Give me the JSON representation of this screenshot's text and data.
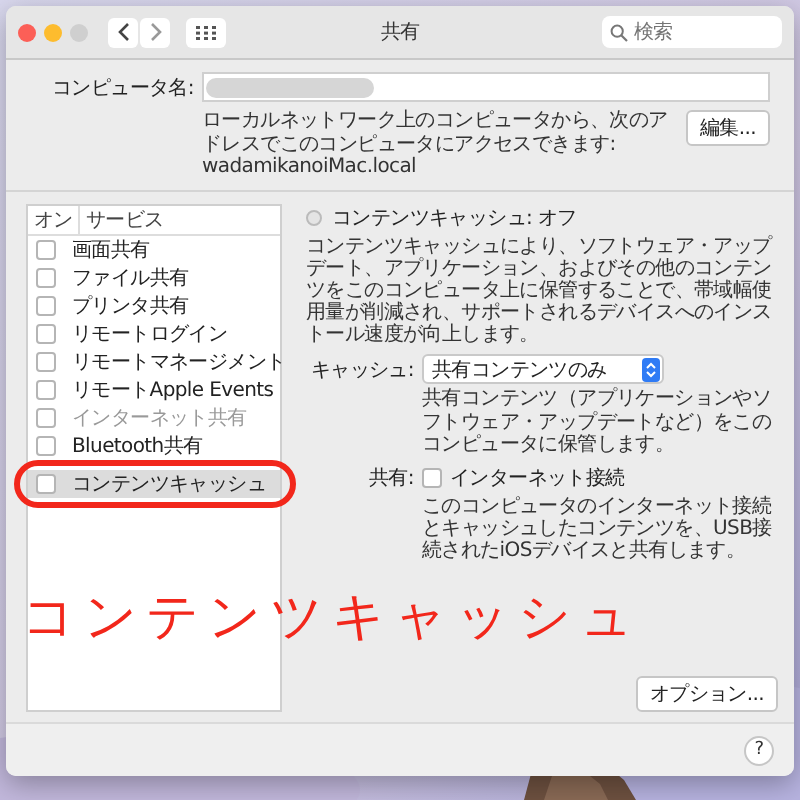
{
  "window": {
    "title": "共有",
    "search": {
      "placeholder": "検索"
    }
  },
  "computer_name": {
    "label": "コンピュータ名:",
    "description": "ローカルネットワーク上のコンピュータから、次のアドレスでこのコンピュータにアクセスできます: wadamikanoiMac.local",
    "edit_button": "編集..."
  },
  "services": {
    "columns": [
      "オン",
      "サービス"
    ],
    "items": [
      {
        "name": "画面共有",
        "checked": false,
        "selected": false,
        "disabled": false
      },
      {
        "name": "ファイル共有",
        "checked": false,
        "selected": false,
        "disabled": false
      },
      {
        "name": "プリンタ共有",
        "checked": false,
        "selected": false,
        "disabled": false
      },
      {
        "name": "リモートログイン",
        "checked": false,
        "selected": false,
        "disabled": false
      },
      {
        "name": "リモートマネージメント",
        "checked": false,
        "selected": false,
        "disabled": false
      },
      {
        "name": "リモートApple Events",
        "checked": false,
        "selected": false,
        "disabled": false
      },
      {
        "name": "インターネット共有",
        "checked": false,
        "selected": false,
        "disabled": true
      },
      {
        "name": "Bluetooth共有",
        "checked": false,
        "selected": false,
        "disabled": false
      },
      {
        "name": "コンテンツキャッシュ",
        "checked": false,
        "selected": true,
        "disabled": false
      }
    ]
  },
  "detail": {
    "status_label": "コンテンツキャッシュ: オフ",
    "status_on": false,
    "description": "コンテンツキャッシュにより、ソフトウェア・アップデート、アプリケーション、およびその他のコンテンツをこのコンピュータ上に保管することで、帯域幅使用量が削減され、サポートされるデバイスへのインストール速度が向上します。",
    "cache_label": "キャッシュ:",
    "cache_value": "共有コンテンツのみ",
    "cache_note": "共有コンテンツ（アプリケーションやソフトウェア・アップデートなど）をこのコンピュータに保管します。",
    "share_label": "共有:",
    "share_option": {
      "label": "インターネット接続",
      "checked": false
    },
    "share_note": "このコンピュータのインターネット接続とキャッシュしたコンテンツを、USB接続されたiOSデバイスと共有します。",
    "options_button": "オプション..."
  },
  "help_button": "?",
  "annotation": {
    "caption": "コンテンツキャッシュ"
  }
}
